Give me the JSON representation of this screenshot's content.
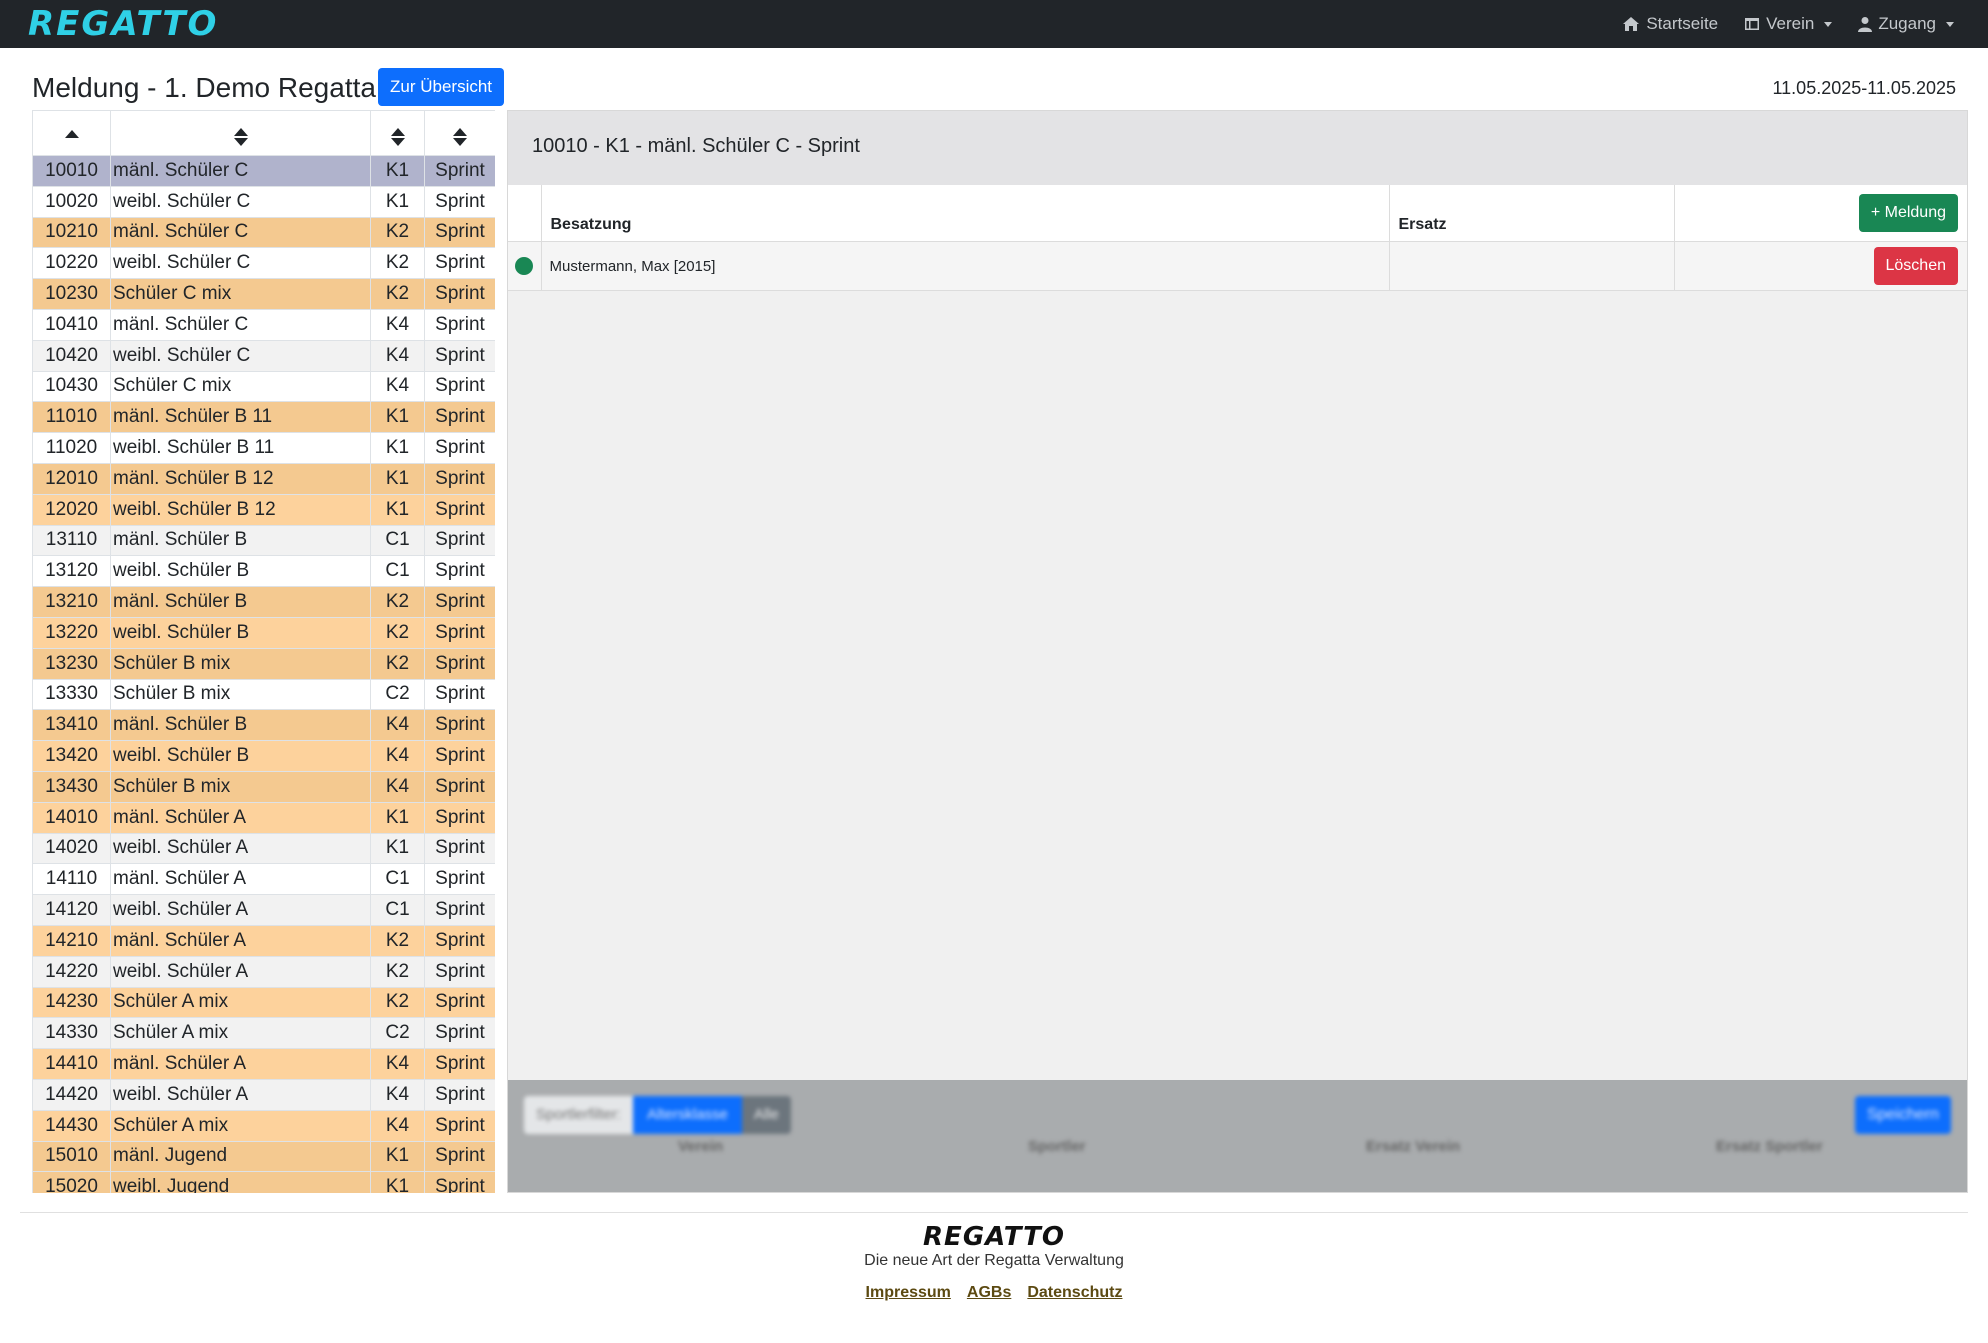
{
  "navbar": {
    "brand": "REGATTO",
    "links": [
      {
        "label": "Startseite",
        "icon": "house-icon"
      },
      {
        "label": "Verein",
        "icon": "table-icon"
      },
      {
        "label": "Zugang",
        "icon": "person-icon"
      }
    ]
  },
  "header": {
    "title": "Meldung - 1. Demo Regatta",
    "overview_button": "Zur Übersicht",
    "date_range": "11.05.2025-11.05.2025"
  },
  "races": [
    {
      "num": "10010",
      "name": "mänl. Schüler C",
      "boat": "K1",
      "distance": "Sprint",
      "color": "sel"
    },
    {
      "num": "10020",
      "name": "weibl. Schüler C",
      "boat": "K1",
      "distance": "Sprint",
      "color": "white"
    },
    {
      "num": "10210",
      "name": "mänl. Schüler C",
      "boat": "K2",
      "distance": "Sprint",
      "color": "orange"
    },
    {
      "num": "10220",
      "name": "weibl. Schüler C",
      "boat": "K2",
      "distance": "Sprint",
      "color": "white"
    },
    {
      "num": "10230",
      "name": "Schüler C mix",
      "boat": "K2",
      "distance": "Sprint",
      "color": "orange"
    },
    {
      "num": "10410",
      "name": "mänl. Schüler C",
      "boat": "K4",
      "distance": "Sprint",
      "color": "white"
    },
    {
      "num": "10420",
      "name": "weibl. Schüler C",
      "boat": "K4",
      "distance": "Sprint",
      "color": "grey"
    },
    {
      "num": "10430",
      "name": "Schüler C mix",
      "boat": "K4",
      "distance": "Sprint",
      "color": "white"
    },
    {
      "num": "11010",
      "name": "mänl. Schüler B 11",
      "boat": "K1",
      "distance": "Sprint",
      "color": "orange"
    },
    {
      "num": "11020",
      "name": "weibl. Schüler B 11",
      "boat": "K1",
      "distance": "Sprint",
      "color": "white"
    },
    {
      "num": "12010",
      "name": "mänl. Schüler B 12",
      "boat": "K1",
      "distance": "Sprint",
      "color": "orange"
    },
    {
      "num": "12020",
      "name": "weibl. Schüler B 12",
      "boat": "K1",
      "distance": "Sprint",
      "color": "lorange"
    },
    {
      "num": "13110",
      "name": "mänl. Schüler B",
      "boat": "C1",
      "distance": "Sprint",
      "color": "grey"
    },
    {
      "num": "13120",
      "name": "weibl. Schüler B",
      "boat": "C1",
      "distance": "Sprint",
      "color": "white"
    },
    {
      "num": "13210",
      "name": "mänl. Schüler B",
      "boat": "K2",
      "distance": "Sprint",
      "color": "orange"
    },
    {
      "num": "13220",
      "name": "weibl. Schüler B",
      "boat": "K2",
      "distance": "Sprint",
      "color": "lorange"
    },
    {
      "num": "13230",
      "name": "Schüler B mix",
      "boat": "K2",
      "distance": "Sprint",
      "color": "orange"
    },
    {
      "num": "13330",
      "name": "Schüler B mix",
      "boat": "C2",
      "distance": "Sprint",
      "color": "white"
    },
    {
      "num": "13410",
      "name": "mänl. Schüler B",
      "boat": "K4",
      "distance": "Sprint",
      "color": "orange"
    },
    {
      "num": "13420",
      "name": "weibl. Schüler B",
      "boat": "K4",
      "distance": "Sprint",
      "color": "lorange"
    },
    {
      "num": "13430",
      "name": "Schüler B mix",
      "boat": "K4",
      "distance": "Sprint",
      "color": "orange"
    },
    {
      "num": "14010",
      "name": "mänl. Schüler A",
      "boat": "K1",
      "distance": "Sprint",
      "color": "lorange"
    },
    {
      "num": "14020",
      "name": "weibl. Schüler A",
      "boat": "K1",
      "distance": "Sprint",
      "color": "grey"
    },
    {
      "num": "14110",
      "name": "mänl. Schüler A",
      "boat": "C1",
      "distance": "Sprint",
      "color": "white"
    },
    {
      "num": "14120",
      "name": "weibl. Schüler A",
      "boat": "C1",
      "distance": "Sprint",
      "color": "grey"
    },
    {
      "num": "14210",
      "name": "mänl. Schüler A",
      "boat": "K2",
      "distance": "Sprint",
      "color": "lorange"
    },
    {
      "num": "14220",
      "name": "weibl. Schüler A",
      "boat": "K2",
      "distance": "Sprint",
      "color": "grey"
    },
    {
      "num": "14230",
      "name": "Schüler A mix",
      "boat": "K2",
      "distance": "Sprint",
      "color": "lorange"
    },
    {
      "num": "14330",
      "name": "Schüler A mix",
      "boat": "C2",
      "distance": "Sprint",
      "color": "grey"
    },
    {
      "num": "14410",
      "name": "mänl. Schüler A",
      "boat": "K4",
      "distance": "Sprint",
      "color": "lorange"
    },
    {
      "num": "14420",
      "name": "weibl. Schüler A",
      "boat": "K4",
      "distance": "Sprint",
      "color": "grey"
    },
    {
      "num": "14430",
      "name": "Schüler A mix",
      "boat": "K4",
      "distance": "Sprint",
      "color": "lorange"
    },
    {
      "num": "15010",
      "name": "mänl. Jugend",
      "boat": "K1",
      "distance": "Sprint",
      "color": "orange"
    },
    {
      "num": "15020",
      "name": "weibl. Jugend",
      "boat": "K1",
      "distance": "Sprint",
      "color": "orange"
    }
  ],
  "detail": {
    "title": "10010 - K1 - mänl. Schüler C - Sprint",
    "col_crew": "Besatzung",
    "col_substitute": "Ersatz",
    "add_button": "+ Meldung",
    "entries": [
      {
        "athlete": "Mustermann, Max [2015]",
        "substitute": "",
        "delete_label": "Löschen",
        "status_color": "#198754"
      }
    ]
  },
  "filter": {
    "label": "Sportlerfilter:",
    "age_class": "Altersklasse",
    "all": "Alle",
    "save": "Speichern",
    "columns": [
      "Verein",
      "Sportler",
      "Ersatz Verein",
      "Ersatz Sportler"
    ]
  },
  "footer": {
    "brand": "REGATTO",
    "tagline": "Die neue Art der Regatta Verwaltung",
    "links": [
      "Impressum",
      "AGBs",
      "Datenschutz"
    ]
  },
  "colors": {
    "navbar": "#212529",
    "brand": "#2fd0e6",
    "primary": "#0d6efd",
    "success": "#198754",
    "danger": "#dc3545",
    "row_selected": "#b0b3cc",
    "row_orange": "#f4c990",
    "row_light_orange": "#fdd29c"
  }
}
